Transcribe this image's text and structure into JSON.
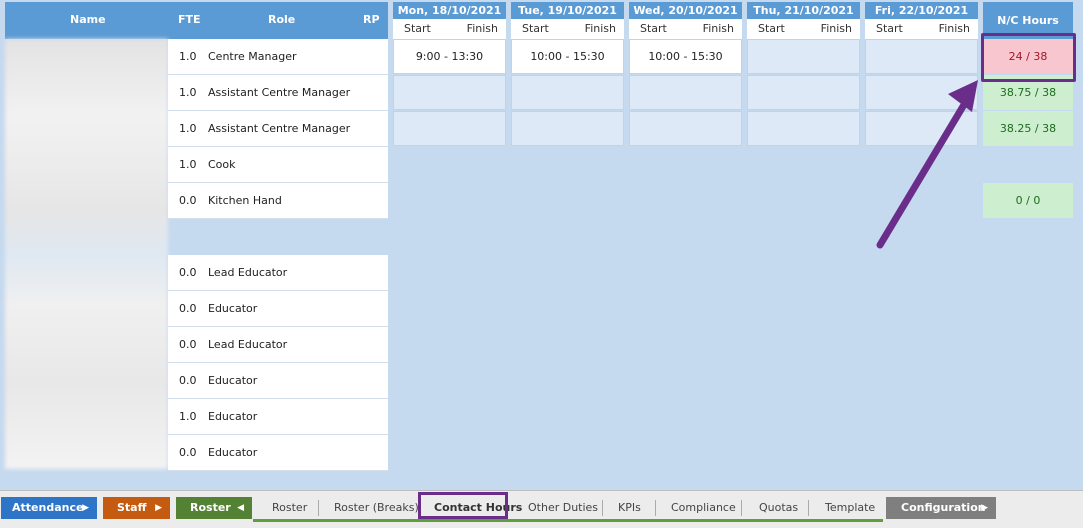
{
  "header": {
    "name_label": "Name",
    "fte_label": "FTE",
    "role_label": "Role",
    "rp_label": "RP",
    "nc_label": "N/C Hours",
    "start_label": "Start",
    "finish_label": "Finish",
    "days": [
      {
        "label": "Mon, 18/10/2021"
      },
      {
        "label": "Tue, 19/10/2021"
      },
      {
        "label": "Wed, 20/10/2021"
      },
      {
        "label": "Thu, 21/10/2021"
      },
      {
        "label": "Fri, 22/10/2021"
      }
    ]
  },
  "rows": [
    {
      "fte": "1.0",
      "role": "Centre Manager",
      "nc": "24 / 38",
      "nc_status": "under",
      "times": [
        "9:00  -  13:30",
        "10:00  -  15:30",
        "10:00  -  15:30",
        "",
        ""
      ]
    },
    {
      "fte": "1.0",
      "role": "Assistant Centre Manager",
      "nc": "38.75 / 38",
      "nc_status": "ok",
      "times": [
        "",
        "",
        "",
        "",
        ""
      ]
    },
    {
      "fte": "1.0",
      "role": "Assistant Centre Manager",
      "nc": "38.25 / 38",
      "nc_status": "ok",
      "times": [
        "",
        "",
        "",
        "",
        ""
      ]
    },
    {
      "fte": "1.0",
      "role": "Cook",
      "nc": "",
      "nc_status": "none",
      "times": []
    },
    {
      "fte": "0.0",
      "role": "Kitchen Hand",
      "nc": "0 / 0",
      "nc_status": "ok",
      "times": []
    },
    {
      "fte": "0.0",
      "role": "Lead Educator",
      "nc": "",
      "nc_status": "none",
      "times": []
    },
    {
      "fte": "0.0",
      "role": "Educator",
      "nc": "",
      "nc_status": "none",
      "times": []
    },
    {
      "fte": "0.0",
      "role": "Lead Educator",
      "nc": "",
      "nc_status": "none",
      "times": []
    },
    {
      "fte": "0.0",
      "role": "Educator",
      "nc": "",
      "nc_status": "none",
      "times": []
    },
    {
      "fte": "1.0",
      "role": "Educator",
      "nc": "",
      "nc_status": "none",
      "times": []
    },
    {
      "fte": "0.0",
      "role": "Educator",
      "nc": "",
      "nc_status": "none",
      "times": []
    }
  ],
  "tabs": {
    "attendance": "Attendance",
    "staff": "Staff",
    "roster": "Roster",
    "configuration": "Configuration",
    "subtabs": [
      "Roster",
      "Roster (Breaks)",
      "Contact Hours",
      "Other Duties",
      "KPIs",
      "Compliance",
      "Quotas",
      "Template"
    ],
    "active_subtab": "Contact Hours"
  },
  "colors": {
    "header_blue": "#5b9bd5",
    "attendance": "#2e75c8",
    "staff": "#c55a11",
    "roster": "#548235",
    "configuration": "#7f7f7f",
    "highlight": "#6a2d8a"
  }
}
